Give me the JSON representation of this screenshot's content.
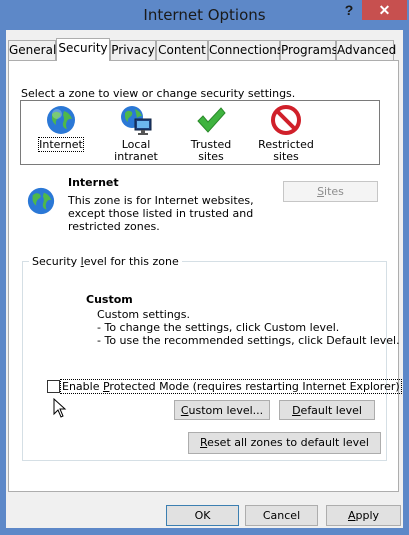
{
  "window": {
    "title": "Internet Options"
  },
  "titlebar": {
    "help_glyph": "?",
    "close_glyph": "✕"
  },
  "tabs": [
    {
      "label": "General"
    },
    {
      "label": "Security"
    },
    {
      "label": "Privacy"
    },
    {
      "label": "Content"
    },
    {
      "label": "Connections"
    },
    {
      "label": "Programs"
    },
    {
      "label": "Advanced"
    }
  ],
  "security": {
    "select_zone_label": "Select a zone to view or change security settings.",
    "zones": [
      {
        "label": "Internet",
        "icon": "globe-icon",
        "selected": true
      },
      {
        "label": "Local intranet",
        "icon": "intranet-icon",
        "selected": false
      },
      {
        "label": "Trusted sites",
        "icon": "checkmark-icon",
        "selected": false
      },
      {
        "label_line1": "Restricted",
        "label_line2": "sites",
        "icon": "restricted-icon",
        "selected": false
      }
    ],
    "zone_info": {
      "title": "Internet",
      "desc_line1": "This zone is for Internet websites,",
      "desc_line2": "except those listed in trusted and",
      "desc_line3": "restricted zones."
    },
    "sites_button": "Sites",
    "level_group_title": "Security level for this zone",
    "level": {
      "title": "Custom",
      "line1": "Custom settings.",
      "line2": "- To change the settings, click Custom level.",
      "line3": "- To use the recommended settings, click Default level."
    },
    "protected_mode_label": "Enable Protected Mode (requires restarting Internet Explorer)",
    "protected_mode_checked": false,
    "custom_level_button": "Custom level...",
    "default_level_button": "Default level",
    "reset_all_button": "Reset all zones to default level"
  },
  "footer": {
    "ok": "OK",
    "cancel": "Cancel",
    "apply": "Apply"
  },
  "colors": {
    "frame": "#5d88c8",
    "close": "#c7504f",
    "panel": "#ffffff",
    "client": "#f0f0f0"
  }
}
